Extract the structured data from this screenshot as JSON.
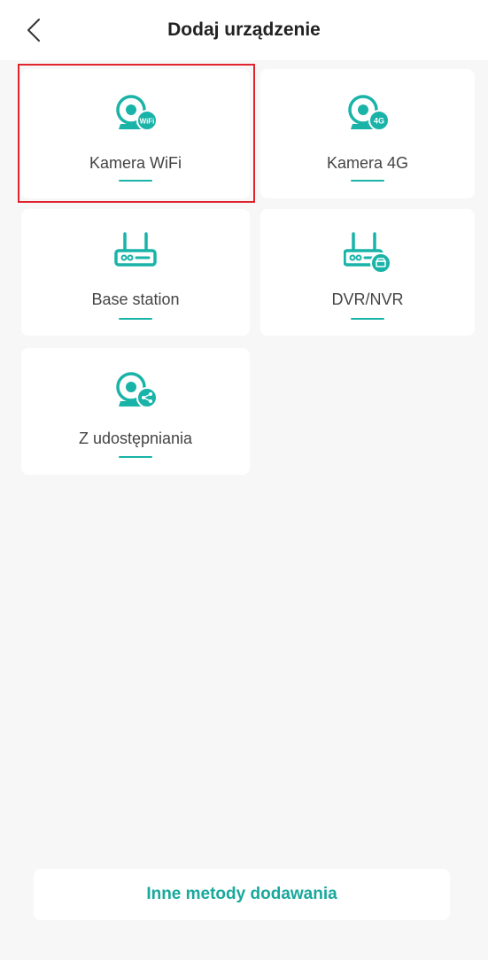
{
  "header": {
    "title": "Dodaj urządzenie"
  },
  "devices": [
    {
      "label": "Kamera WiFi",
      "icon": "camera-wifi-icon",
      "badge": "WiFi"
    },
    {
      "label": "Kamera 4G",
      "icon": "camera-4g-icon",
      "badge": "4G"
    },
    {
      "label": "Base station",
      "icon": "base-station-icon"
    },
    {
      "label": "DVR/NVR",
      "icon": "dvr-nvr-icon"
    },
    {
      "label": "Z udostępniania",
      "icon": "camera-share-icon"
    }
  ],
  "footer": {
    "other_methods_label": "Inne metody dodawania"
  },
  "colors": {
    "accent": "#19b3a8",
    "highlight": "#e0242e",
    "background": "#f7f7f7"
  }
}
